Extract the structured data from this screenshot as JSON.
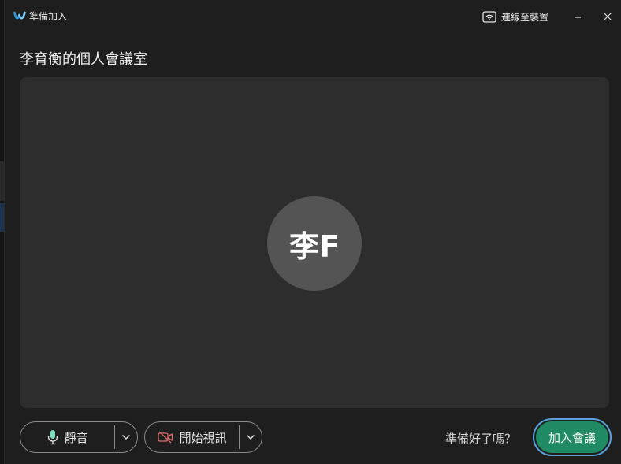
{
  "window": {
    "title": "準備加入",
    "connect_device_label": "連線至裝置",
    "minimize_label": "minimize",
    "close_label": "close"
  },
  "room": {
    "title": "李育衡的個人會議室"
  },
  "preview": {
    "avatar_initials": "李F",
    "avatar_color": "#545454"
  },
  "controls": {
    "mute_label": "靜音",
    "video_label": "開始視訊",
    "ready_text": "準備好了嗎？",
    "join_label": "加入會議"
  },
  "colors": {
    "accent": "#1f8a63",
    "focus_ring": "#5aa0d8",
    "mic_icon": "#7fe0c0",
    "camera_off_icon": "#e06a6a"
  },
  "icons": [
    "webex-logo-icon",
    "cast-device-icon",
    "minimize-icon",
    "close-icon",
    "microphone-icon",
    "chevron-down-icon",
    "camera-off-icon"
  ]
}
